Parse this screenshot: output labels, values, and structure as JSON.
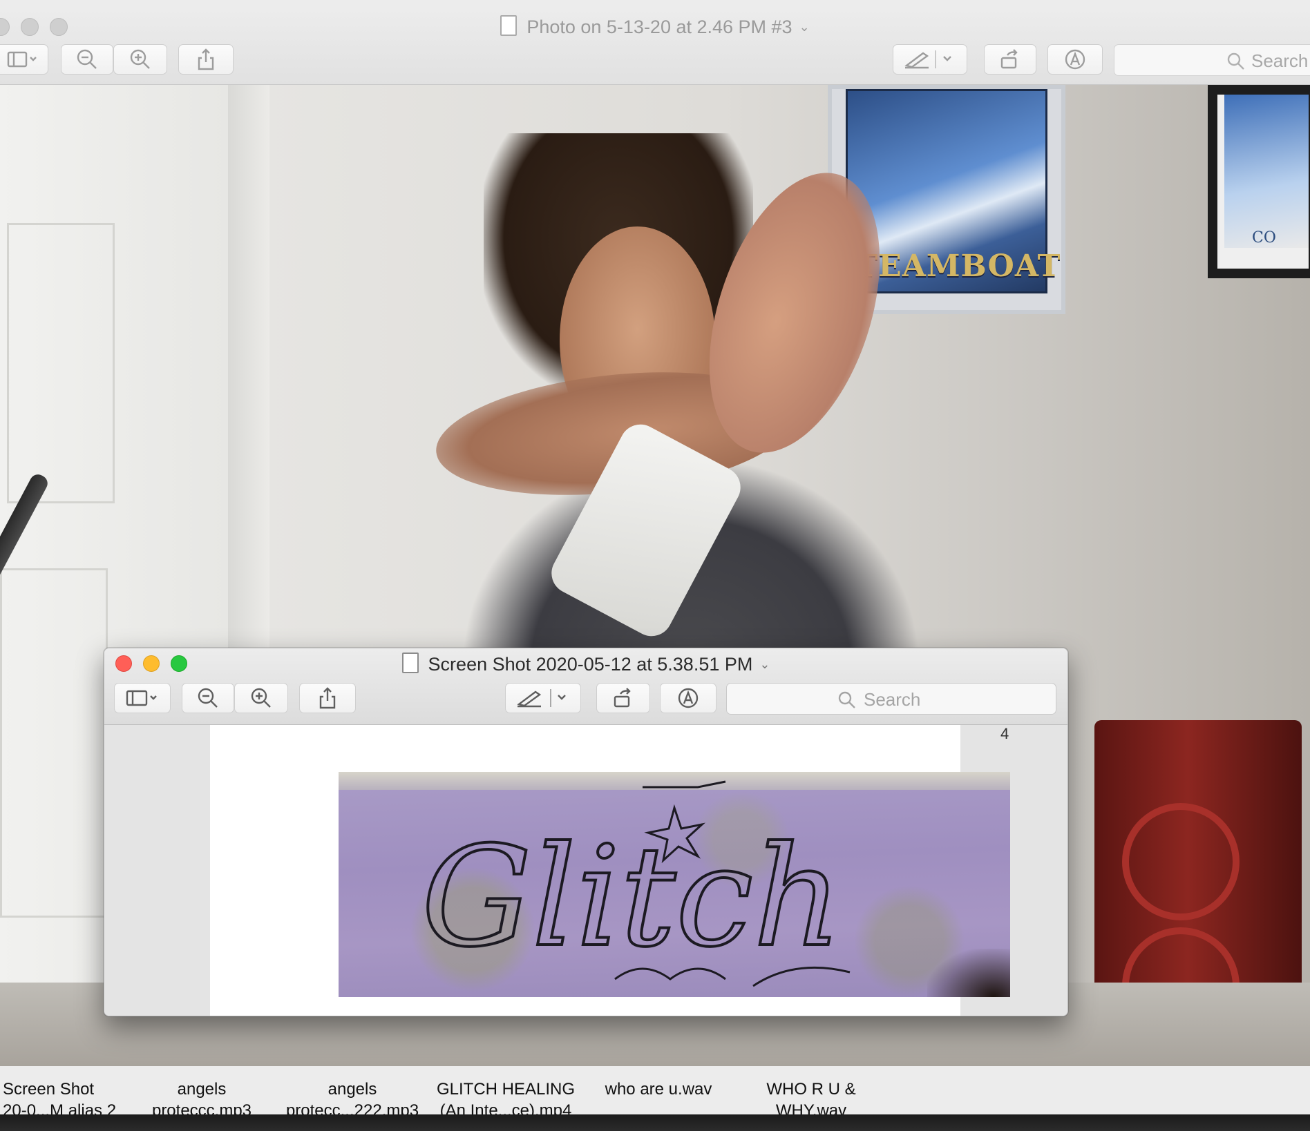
{
  "back_window": {
    "title": "Photo on 5-13-20 at 2.46 PM #3",
    "search_placeholder": "Search",
    "toolbar": {
      "sidebar_icon": "sidebar-icon",
      "zoom_out_icon": "zoom-out-icon",
      "zoom_in_icon": "zoom-in-icon",
      "share_icon": "share-icon",
      "markup_pen_icon": "pen-icon",
      "rotate_icon": "rotate-icon",
      "annotate_icon": "annotate-icon"
    }
  },
  "photo": {
    "poster_text": "STEAMBOAT",
    "poster2_text": "CO"
  },
  "front_window": {
    "title": "Screen Shot 2020-05-12 at 5.38.51 PM",
    "search_placeholder": "Search",
    "page_number": "4",
    "image_handwriting": "Glitch"
  },
  "desktop_files": [
    {
      "line1": "Screen Shot",
      "line2": "20-0...M alias 2"
    },
    {
      "line1": "angels",
      "line2": "proteccc.mp3"
    },
    {
      "line1": "angels",
      "line2": "protecc...222.mp3"
    },
    {
      "line1": "GLITCH HEALING",
      "line2": "(An Inte...ce).mp4"
    },
    {
      "line1": "who are u.wav",
      "line2": ""
    },
    {
      "line1": "WHO R U &",
      "line2": "WHY.wav"
    }
  ]
}
